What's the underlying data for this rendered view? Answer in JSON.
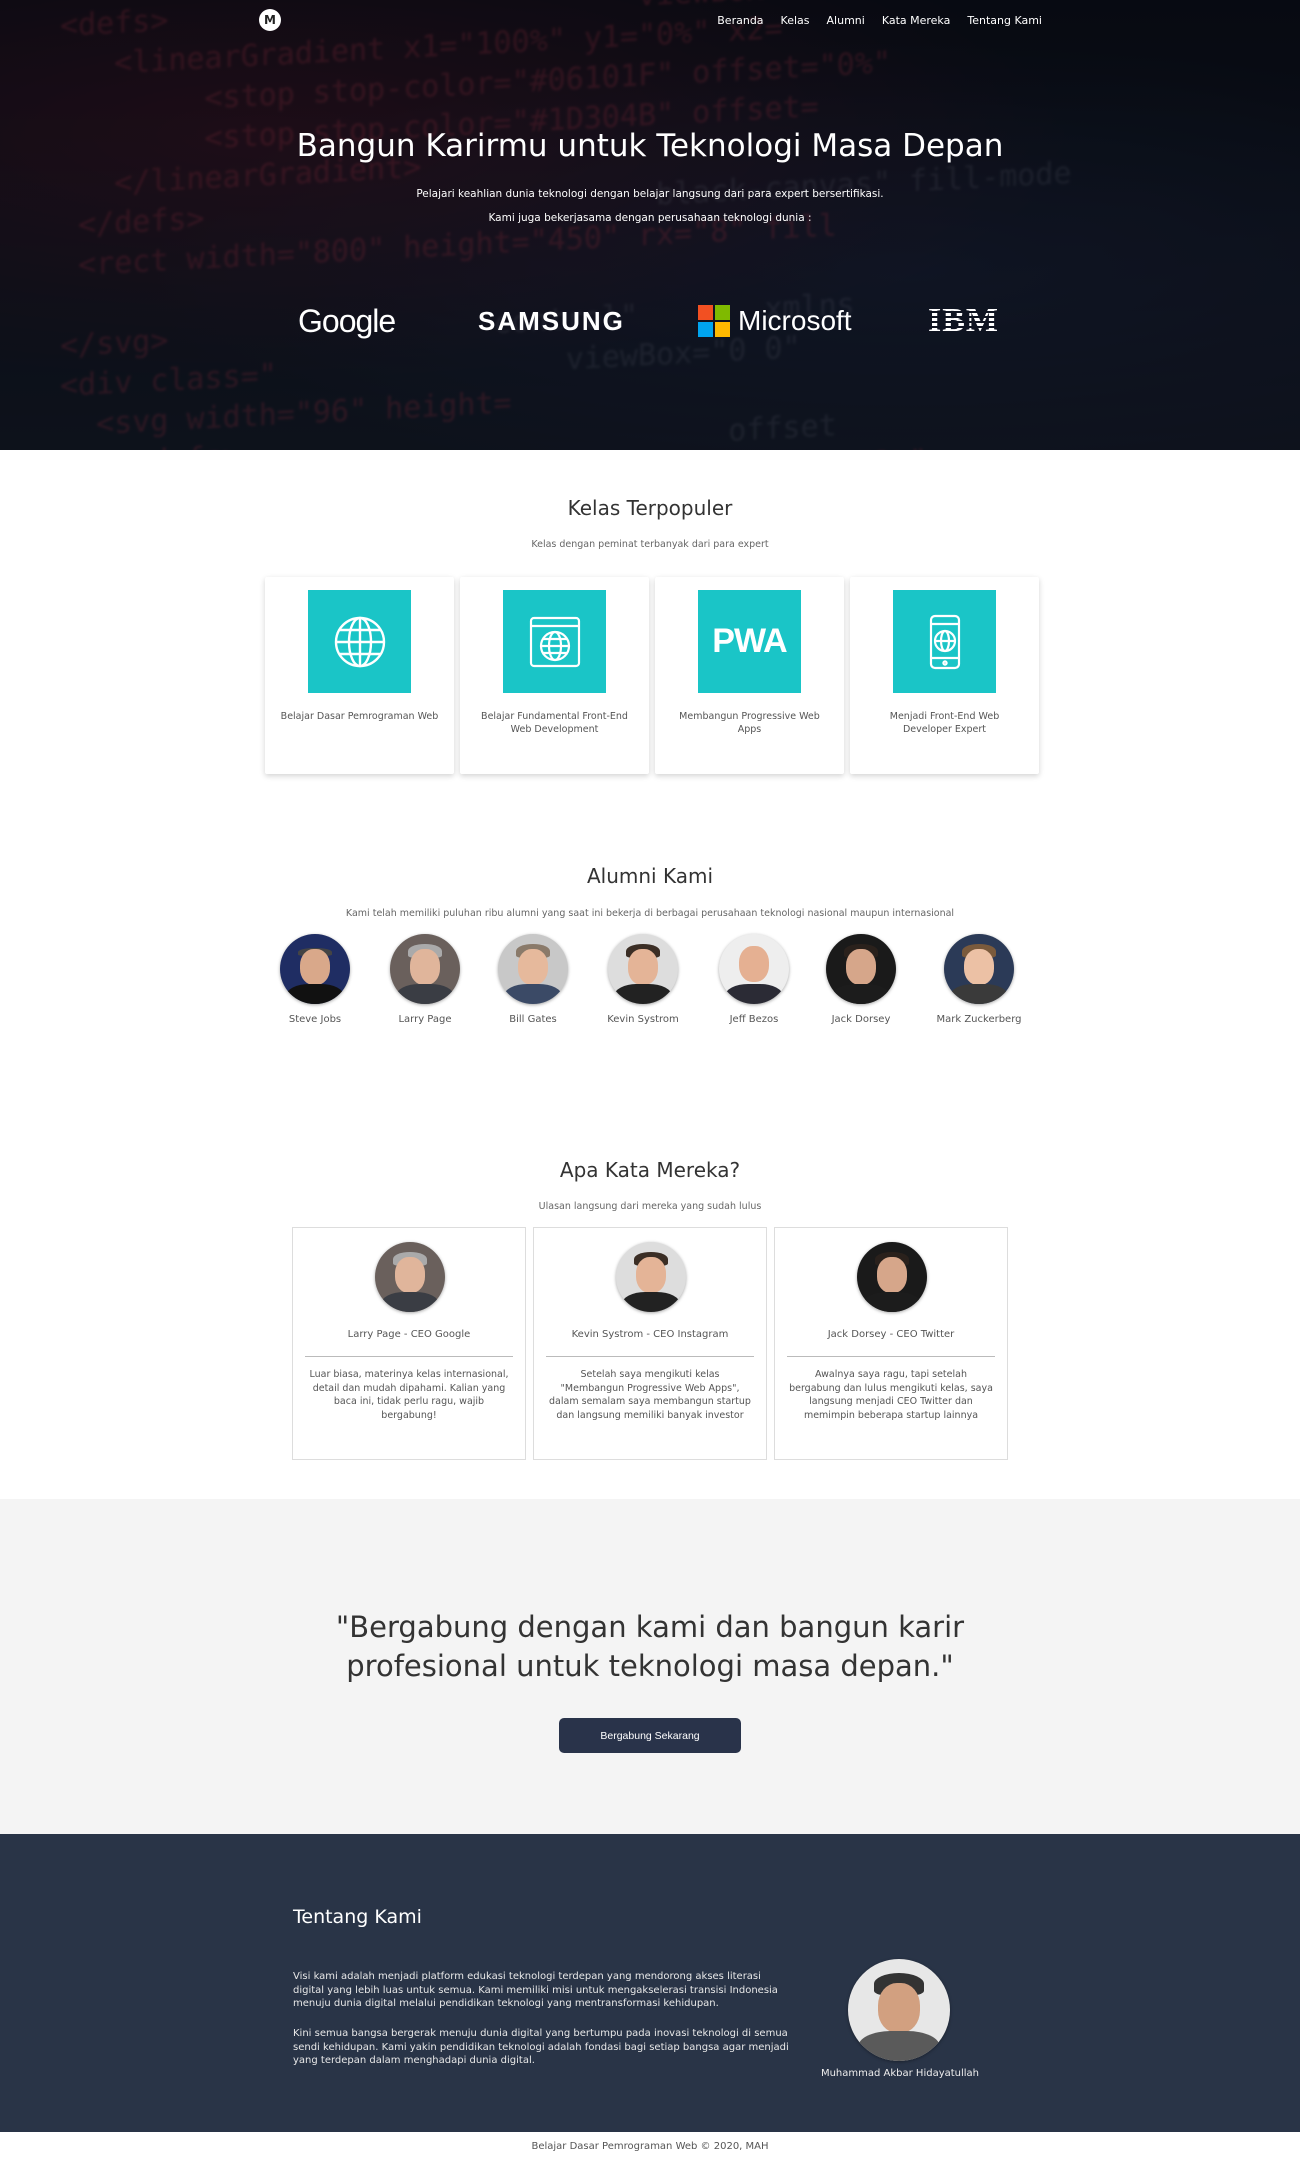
{
  "nav": {
    "logo": "M",
    "items": [
      "Beranda",
      "Kelas",
      "Alumni",
      "Kata Mereka",
      "Tentang Kami"
    ]
  },
  "hero": {
    "title": "Bangun Karirmu untuk Teknologi Masa Depan",
    "subtitle": "Pelajari keahlian dunia teknologi dengan belajar langsung dari para expert bersertifikasi.",
    "partners_text": "Kami juga bekerjasama dengan perusahaan teknologi dunia :",
    "partners": [
      "Google",
      "SAMSUNG",
      "Microsoft",
      "IBM"
    ]
  },
  "classes": {
    "title": "Kelas Terpopuler",
    "subtitle": "Kelas dengan peminat terbanyak dari para expert",
    "items": [
      {
        "title": "Belajar Dasar Pemrograman Web",
        "icon": "globe-icon"
      },
      {
        "title": "Belajar Fundamental Front-End Web Development",
        "icon": "browser-globe-icon"
      },
      {
        "title": "Membangun Progressive Web Apps",
        "icon": "pwa-logo",
        "logo_text": "PWA"
      },
      {
        "title": "Menjadi Front-End Web Developer Expert",
        "icon": "mobile-globe-icon"
      }
    ]
  },
  "alumni": {
    "title": "Alumni Kami",
    "subtitle": "Kami telah memiliki puluhan ribu alumni yang saat ini bekerja di berbagai perusahaan teknologi nasional maupun internasional",
    "people": [
      "Steve Jobs",
      "Larry Page",
      "Bill Gates",
      "Kevin Systrom",
      "Jeff Bezos",
      "Jack Dorsey",
      "Mark Zuckerberg"
    ]
  },
  "testimonials": {
    "title": "Apa Kata Mereka?",
    "subtitle": "Ulasan langsung dari mereka yang sudah lulus",
    "items": [
      {
        "name": "Larry Page - CEO Google",
        "quote": "Luar biasa, materinya kelas internasional, detail dan mudah dipahami. Kalian yang baca ini, tidak perlu ragu, wajib bergabung!"
      },
      {
        "name": "Kevin Systrom - CEO Instagram",
        "quote": "Setelah saya mengikuti kelas \"Membangun Progressive Web Apps\", dalam semalam saya membangun startup dan langsung memiliki banyak investor"
      },
      {
        "name": "Jack Dorsey - CEO Twitter",
        "quote": "Awalnya saya ragu, tapi setelah bergabung dan lulus mengikuti kelas, saya langsung menjadi CEO Twitter dan memimpin beberapa startup lainnya"
      }
    ]
  },
  "cta": {
    "text": "\"Bergabung dengan kami dan bangun karir profesional untuk teknologi masa depan.\"",
    "button": "Bergabung Sekarang"
  },
  "about": {
    "title": "Tentang Kami",
    "p1": "Visi kami adalah menjadi platform edukasi teknologi terdepan yang mendorong akses literasi digital yang lebih luas untuk semua. Kami memiliki misi untuk mengakselerasi transisi Indonesia menuju dunia digital melalui pendidikan teknologi yang mentransformasi kehidupan.",
    "p2": "Kini semua bangsa bergerak menuju dunia digital yang bertumpu pada inovasi teknologi di semua sendi kehidupan. Kami yakin pendidikan teknologi adalah fondasi bagi setiap bangsa agar menjadi yang terdepan dalam menghadapi dunia digital.",
    "author": "Muhammad Akbar Hidayatullah"
  },
  "footer": {
    "copyright": "Belajar Dasar Pemrograman Web © 2020, MAH"
  },
  "colors": {
    "accent": "#1ac5c7",
    "dark": "#293447",
    "button": "#29334a"
  }
}
